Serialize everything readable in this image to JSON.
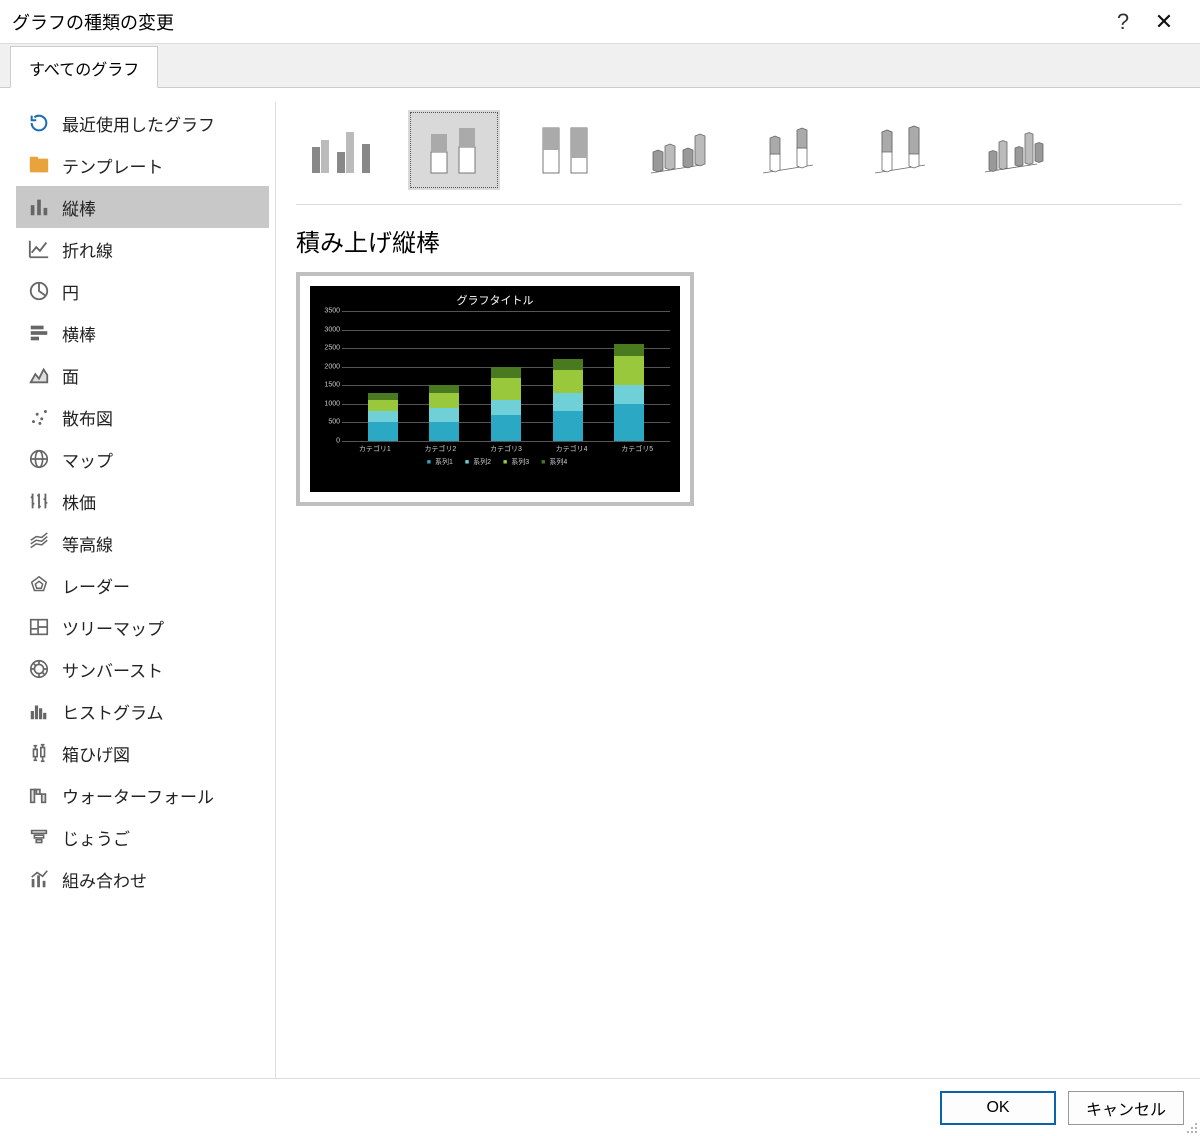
{
  "title": "グラフの種類の変更",
  "help_symbol": "?",
  "close_symbol": "✕",
  "tabs": {
    "all_charts": "すべてのグラフ"
  },
  "sidebar": {
    "items": [
      {
        "id": "recent",
        "label": "最近使用したグラフ"
      },
      {
        "id": "templates",
        "label": "テンプレート"
      },
      {
        "id": "column",
        "label": "縦棒",
        "selected": true
      },
      {
        "id": "line",
        "label": "折れ線"
      },
      {
        "id": "pie",
        "label": "円"
      },
      {
        "id": "bar",
        "label": "横棒"
      },
      {
        "id": "area",
        "label": "面"
      },
      {
        "id": "scatter",
        "label": "散布図"
      },
      {
        "id": "map",
        "label": "マップ"
      },
      {
        "id": "stock",
        "label": "株価"
      },
      {
        "id": "surface",
        "label": "等高線"
      },
      {
        "id": "radar",
        "label": "レーダー"
      },
      {
        "id": "treemap",
        "label": "ツリーマップ"
      },
      {
        "id": "sunburst",
        "label": "サンバースト"
      },
      {
        "id": "histogram",
        "label": "ヒストグラム"
      },
      {
        "id": "boxwhisker",
        "label": "箱ひげ図"
      },
      {
        "id": "waterfall",
        "label": "ウォーターフォール"
      },
      {
        "id": "funnel",
        "label": "じょうご"
      },
      {
        "id": "combo",
        "label": "組み合わせ"
      }
    ]
  },
  "subtype_title": "積み上げ縦棒",
  "subtypes": [
    {
      "id": "clustered-column"
    },
    {
      "id": "stacked-column",
      "selected": true
    },
    {
      "id": "100-stacked-column"
    },
    {
      "id": "3d-clustered-column"
    },
    {
      "id": "3d-stacked-column"
    },
    {
      "id": "3d-100-stacked-column"
    },
    {
      "id": "3d-column"
    }
  ],
  "preview": {
    "chart_title": "グラフタイトル",
    "legend_prefix": "■",
    "colors": {
      "s1": "#2aa8c4",
      "s2": "#6fd0d8",
      "s3": "#9ac83c",
      "s4": "#4a7a1f"
    }
  },
  "chart_data": {
    "type": "bar",
    "stacked": true,
    "title": "グラフタイトル",
    "categories": [
      "カテゴリ1",
      "カテゴリ2",
      "カテゴリ3",
      "カテゴリ4",
      "カテゴリ5"
    ],
    "series": [
      {
        "name": "系列1",
        "values": [
          500,
          500,
          700,
          800,
          1000
        ]
      },
      {
        "name": "系列2",
        "values": [
          300,
          400,
          400,
          500,
          500
        ]
      },
      {
        "name": "系列3",
        "values": [
          300,
          400,
          600,
          600,
          800
        ]
      },
      {
        "name": "系列4",
        "values": [
          200,
          200,
          300,
          300,
          300
        ]
      }
    ],
    "ylim": [
      0,
      3500
    ],
    "yticks": [
      0,
      500,
      1000,
      1500,
      2000,
      2500,
      3000,
      3500
    ],
    "xlabel": "",
    "ylabel": ""
  },
  "buttons": {
    "ok": "OK",
    "cancel": "キャンセル"
  }
}
